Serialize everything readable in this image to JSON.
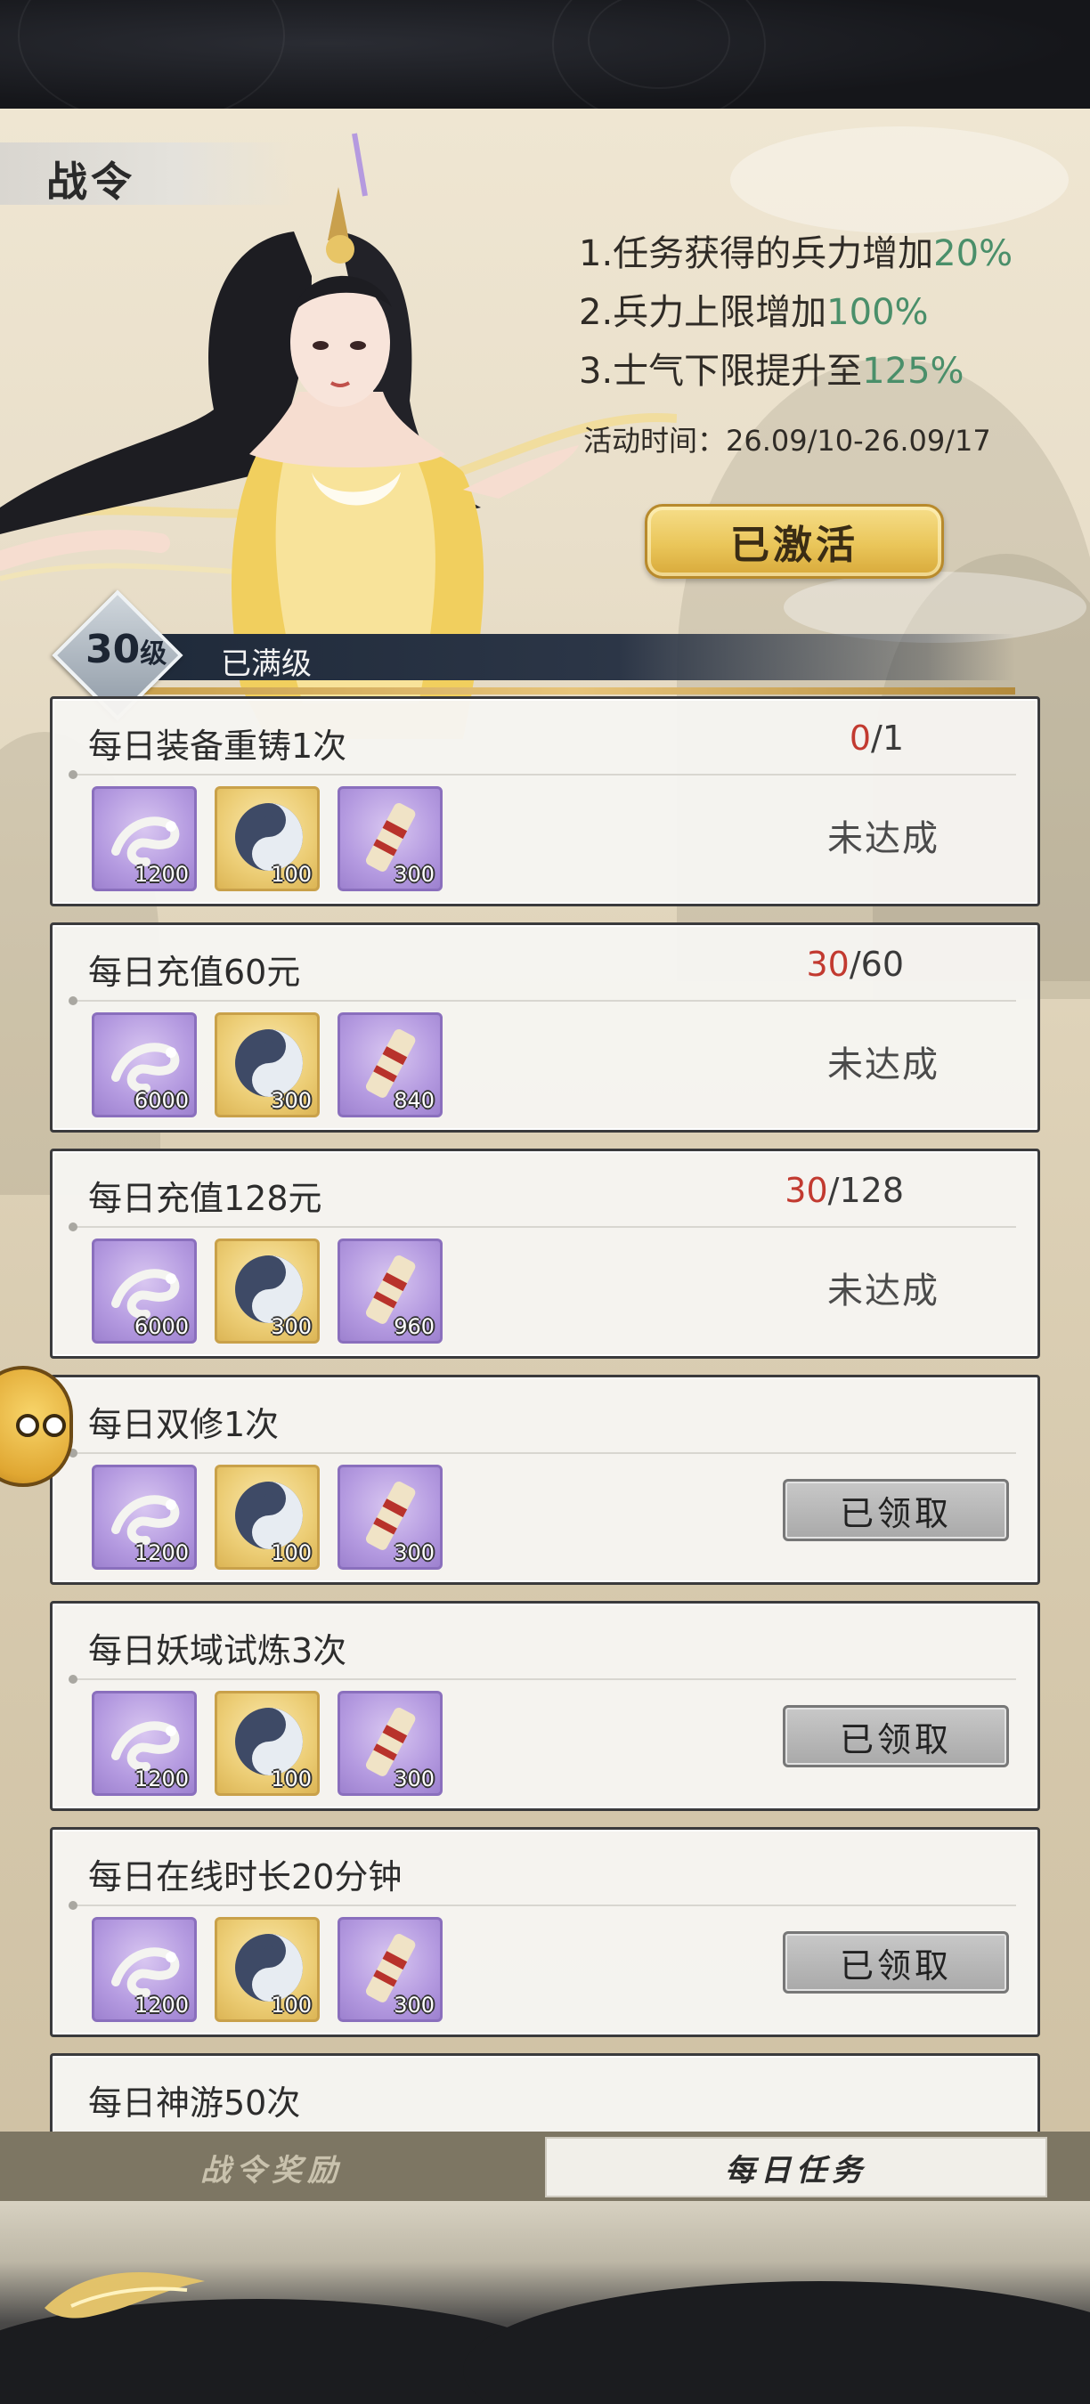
{
  "header": {
    "title": "战令"
  },
  "perks": [
    {
      "prefix": "1.任务获得的兵力增加",
      "value": "20%"
    },
    {
      "prefix": "2.兵力上限增加",
      "value": "100%"
    },
    {
      "prefix": "3.士气下限提升至",
      "value": "125%"
    }
  ],
  "event_time": "活动时间：26.09/10-26.09/17",
  "activated_button": "已激活",
  "level": {
    "value": "30",
    "unit": "级",
    "status": "已满级"
  },
  "tasks": [
    {
      "name": "每日装备重铸1次",
      "progress_current": "0",
      "progress_total": "/1",
      "rewards": [
        {
          "icon": "white-dragon-icon",
          "amount": "1200"
        },
        {
          "icon": "yin-yang-coin-icon",
          "amount": "100"
        },
        {
          "icon": "scroll-icon",
          "amount": "300"
        }
      ],
      "state": "未达成"
    },
    {
      "name": "每日充值60元",
      "progress_current": "30",
      "progress_total": "/60",
      "rewards": [
        {
          "icon": "white-dragon-icon",
          "amount": "6000"
        },
        {
          "icon": "yin-yang-coin-icon",
          "amount": "300"
        },
        {
          "icon": "scroll-icon",
          "amount": "840"
        }
      ],
      "state": "未达成"
    },
    {
      "name": "每日充值128元",
      "progress_current": "30",
      "progress_total": "/128",
      "rewards": [
        {
          "icon": "white-dragon-icon",
          "amount": "6000"
        },
        {
          "icon": "yin-yang-coin-icon",
          "amount": "300"
        },
        {
          "icon": "scroll-icon",
          "amount": "960"
        }
      ],
      "state": "未达成"
    },
    {
      "name": "每日双修1次",
      "rewards": [
        {
          "icon": "white-dragon-icon",
          "amount": "1200"
        },
        {
          "icon": "yin-yang-coin-icon",
          "amount": "100"
        },
        {
          "icon": "scroll-icon",
          "amount": "300"
        }
      ],
      "button": "已领取"
    },
    {
      "name": "每日妖域试炼3次",
      "rewards": [
        {
          "icon": "white-dragon-icon",
          "amount": "1200"
        },
        {
          "icon": "yin-yang-coin-icon",
          "amount": "100"
        },
        {
          "icon": "scroll-icon",
          "amount": "300"
        }
      ],
      "button": "已领取"
    },
    {
      "name": "每日在线时长20分钟",
      "rewards": [
        {
          "icon": "white-dragon-icon",
          "amount": "1200"
        },
        {
          "icon": "yin-yang-coin-icon",
          "amount": "100"
        },
        {
          "icon": "scroll-icon",
          "amount": "300"
        }
      ],
      "button": "已领取"
    },
    {
      "name": "每日神游50次"
    }
  ],
  "tabs": {
    "battle_pass_rewards": "战令奖励",
    "daily_tasks": "每日任务"
  },
  "colors": {
    "highlight": "#4a8f6a",
    "progress_red": "#c23a30",
    "gold_button": "#eac65a"
  }
}
